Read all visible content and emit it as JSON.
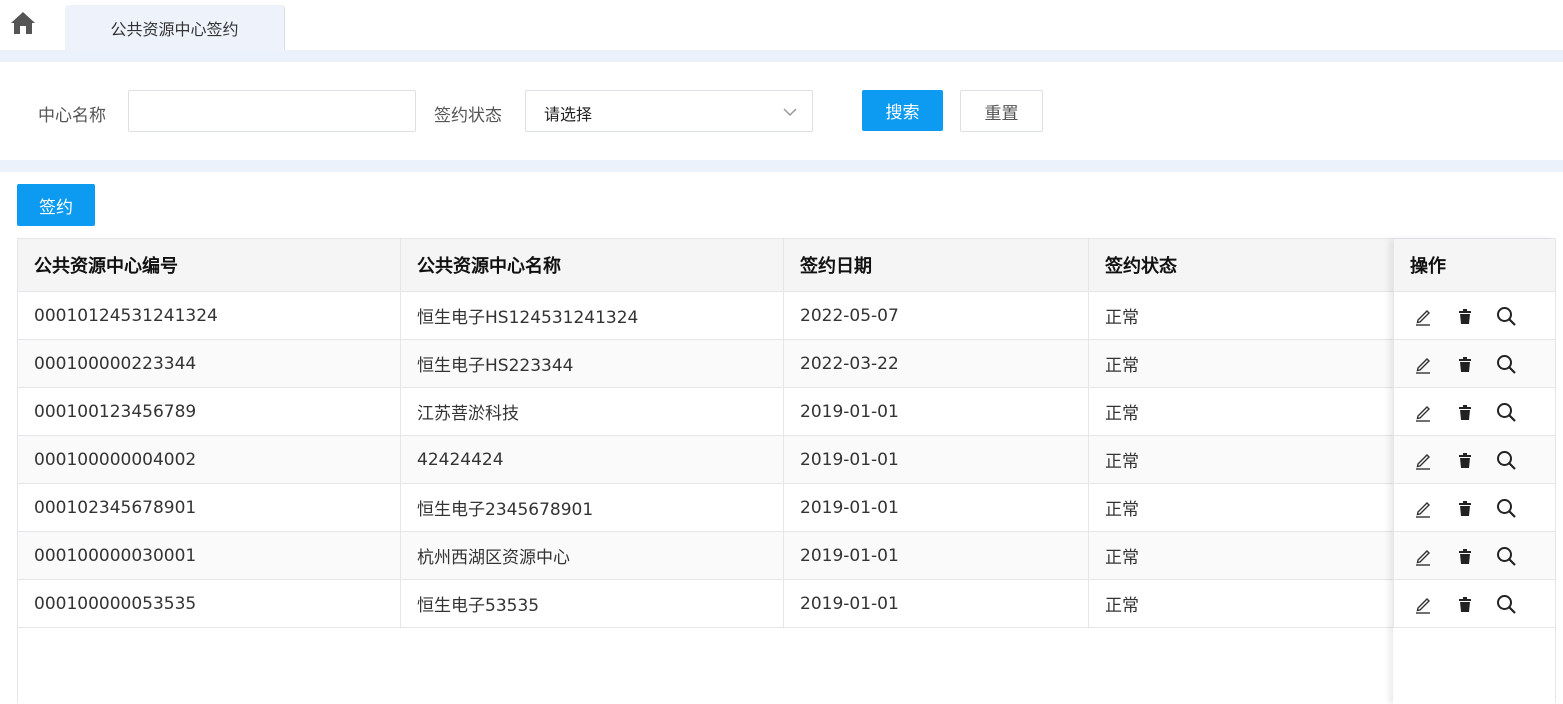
{
  "tabs": [
    {
      "label": "公共资源中心签约",
      "active": true
    }
  ],
  "search": {
    "name_label": "中心名称",
    "name_value": "",
    "status_label": "签约状态",
    "status_placeholder": "请选择",
    "search_button": "搜索",
    "reset_button": "重置"
  },
  "toolbar": {
    "sign_button": "签约"
  },
  "table": {
    "columns": [
      "公共资源中心编号",
      "公共资源中心名称",
      "签约日期",
      "签约状态",
      "操作"
    ],
    "rows": [
      [
        "00010124531241324",
        "恒生电子HS124531241324",
        "2022-05-07",
        "正常"
      ],
      [
        "000100000223344",
        "恒生电子HS223344",
        "2022-03-22",
        "正常"
      ],
      [
        "000100123456789",
        "江苏菩淤科技",
        "2019-01-01",
        "正常"
      ],
      [
        "000100000004002",
        "42424424",
        "2019-01-01",
        "正常"
      ],
      [
        "000102345678901",
        "恒生电子2345678901",
        "2019-01-01",
        "正常"
      ],
      [
        "000100000030001",
        "杭州西湖区资源中心",
        "2019-01-01",
        "正常"
      ],
      [
        "000100000053535",
        "恒生电子53535",
        "2019-01-01",
        "正常"
      ]
    ],
    "row_actions": [
      "edit-icon",
      "trash-icon",
      "search-icon"
    ]
  },
  "colors": {
    "primary": "#0d9bf2",
    "band": "#ecf2fb",
    "tab_bg": "#eef3fb"
  }
}
